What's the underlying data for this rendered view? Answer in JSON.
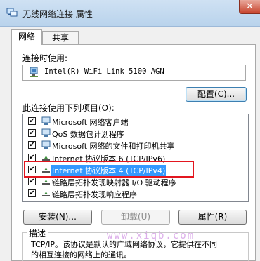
{
  "window": {
    "title": "无线网络连接 属性",
    "close_glyph": "✕"
  },
  "tabs": [
    {
      "label": "网络"
    },
    {
      "label": "共享"
    }
  ],
  "connect_using": {
    "label": "连接时使用:",
    "adapter": "Intel(R) WiFi Link 5100 AGN",
    "configure_button": "配置(C)..."
  },
  "items_label": "此连接使用下列项目(O):",
  "items": [
    {
      "label": "Microsoft 网络客户端",
      "checked": true,
      "icon": "network-client-icon"
    },
    {
      "label": "QoS 数据包计划程序",
      "checked": true,
      "icon": "qos-icon"
    },
    {
      "label": "Microsoft 网络的文件和打印机共享",
      "checked": true,
      "icon": "file-printer-sharing-icon"
    },
    {
      "label": "Internet 协议版本 6 (TCP/IPv6)",
      "checked": true,
      "icon": "protocol-icon"
    },
    {
      "label": "Internet 协议版本 4 (TCP/IPv4)",
      "checked": true,
      "icon": "protocol-icon"
    },
    {
      "label": "链路层拓扑发现映射器 I/O 驱动程序",
      "checked": true,
      "icon": "protocol-icon"
    },
    {
      "label": "链路层拓扑发现响应程序",
      "checked": true,
      "icon": "protocol-icon"
    }
  ],
  "buttons": {
    "install": "安装(N)...",
    "uninstall": "卸载(U)",
    "properties": "属性(R)"
  },
  "description": {
    "label": "描述",
    "line1": "TCP/IP。该协议是默认的广域网络协议，它提供在不同",
    "line2": "的相互连接的网络上的通讯。"
  },
  "watermark": "www.xiqb.com",
  "colors": {
    "selection": "#3399ff",
    "highlight_border": "#e3161f"
  }
}
